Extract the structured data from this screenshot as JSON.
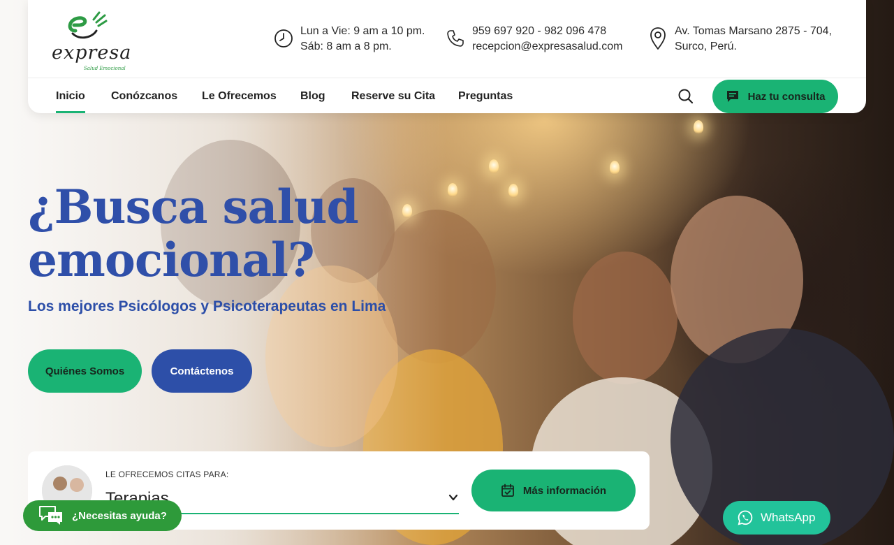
{
  "brand": {
    "name": "expresa",
    "tagline": "Salud Emocional",
    "green": "#1ab374",
    "blue": "#2d4fa8"
  },
  "contact": {
    "hours_line1": "Lun a Vie: 9 am a 10 pm.",
    "hours_line2": "Sáb: 8 am a 8 pm.",
    "phone": "959 697 920 - 982 096 478",
    "email": "recepcion@expresasalud.com",
    "address_line1": "Av. Tomas Marsano 2875 - 704,",
    "address_line2": "Surco, Perú.",
    "icons": [
      "clock-icon",
      "phone-icon",
      "map-pin-icon"
    ]
  },
  "nav": {
    "items": [
      {
        "label": "Inicio",
        "active": true
      },
      {
        "label": "Conózcanos"
      },
      {
        "label": "Le Ofrecemos"
      },
      {
        "label": "Blog"
      },
      {
        "label": "Reserve su Cita"
      },
      {
        "label": "Preguntas"
      }
    ],
    "cta_label": "Haz tu consulta"
  },
  "hero": {
    "headline_line1": "¿Busca salud",
    "headline_line2": "emocional?",
    "subheadline": "Los mejores Psicólogos y Psicoterapeutas en Lima",
    "button_about": "Quiénes Somos",
    "button_contact": "Contáctenos"
  },
  "appointment": {
    "label": "LE OFRECEMOS CITAS PARA:",
    "selected": "Terapias",
    "button": "Más información"
  },
  "widgets": {
    "help_label": "¿Necesitas ayuda?",
    "whatsapp_label": "WhatsApp"
  }
}
